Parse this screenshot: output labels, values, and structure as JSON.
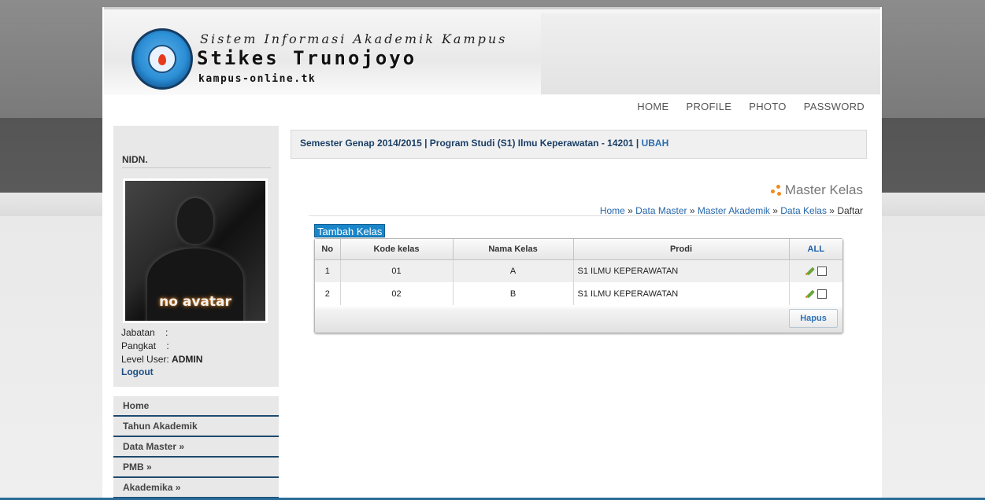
{
  "header": {
    "subtitle": "Sistem Informasi Akademik Kampus",
    "title": "Stikes Trunojoyo",
    "url_text": "kampus-online.tk",
    "nav": [
      "HOME",
      "PROFILE",
      "PHOTO",
      "PASSWORD"
    ]
  },
  "sidebar": {
    "nidn_label": "NIDN.",
    "avatar_caption": "no avatar",
    "jabatan_label": "Jabatan    :",
    "pangkat_label": "Pangkat    :",
    "level_label": "Level User:",
    "level_value": "ADMIN",
    "logout_label": "Logout",
    "menu": [
      "Home",
      "Tahun Akademik",
      "Data Master »",
      "PMB »",
      "Akademika »"
    ]
  },
  "semester_bar": {
    "text": "Semester Genap 2014/2015 | Program Studi (S1) Ilmu Keperawatan - 14201 | ",
    "link": "UBAH"
  },
  "page": {
    "title": "Master Kelas",
    "breadcrumb": [
      "Home",
      "Data Master",
      "Master Akademik",
      "Data Kelas"
    ],
    "breadcrumb_current": "Daftar",
    "add_button": "Tambah Kelas",
    "delete_button": "Hapus"
  },
  "table": {
    "headers": [
      "No",
      "Kode kelas",
      "Nama Kelas",
      "Prodi",
      "ALL"
    ],
    "rows": [
      {
        "no": "1",
        "kode": "01",
        "nama": "A",
        "prodi": "S1 ILMU KEPERAWATAN"
      },
      {
        "no": "2",
        "kode": "02",
        "nama": "B",
        "prodi": "S1 ILMU KEPERAWATAN"
      }
    ]
  },
  "colors": {
    "accent": "#1a86c9",
    "link": "#2566a8",
    "menu_border": "#1e4a6e",
    "title_dot": "#f08c1c"
  }
}
